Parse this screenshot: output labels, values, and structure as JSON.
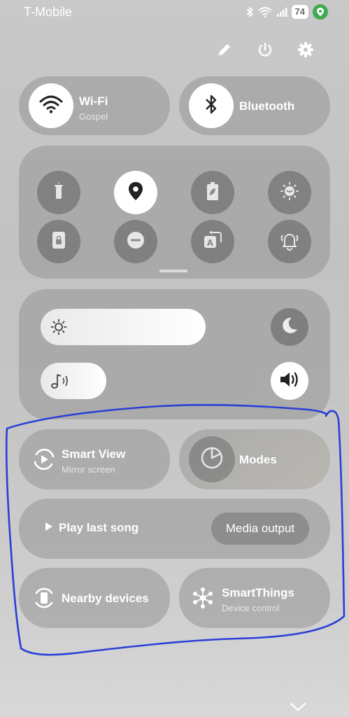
{
  "status_bar": {
    "carrier": "T-Mobile",
    "battery": "74",
    "icons": [
      "bluetooth-icon",
      "wifi-icon",
      "signal-icon",
      "battery-icon",
      "location-badge-icon"
    ]
  },
  "top_actions": [
    "edit-icon",
    "power-icon",
    "settings-icon"
  ],
  "wifi": {
    "title": "Wi-Fi",
    "subtitle": "Gospel",
    "active": true
  },
  "bluetooth": {
    "title": "Bluetooth",
    "active": true
  },
  "quick_toggles": [
    {
      "icon": "flashlight-icon",
      "active": false
    },
    {
      "icon": "location-icon",
      "active": true
    },
    {
      "icon": "power-saving-icon",
      "active": false
    },
    {
      "icon": "eye-comfort-icon",
      "active": false
    },
    {
      "icon": "secure-folder-icon",
      "active": false
    },
    {
      "icon": "do-not-disturb-icon",
      "active": false
    },
    {
      "icon": "auto-rotate-icon",
      "active": false
    },
    {
      "icon": "sound-mode-icon",
      "active": false
    }
  ],
  "sliders": {
    "brightness": {
      "level": 0.75,
      "icon": "sun-icon",
      "side_icon": "moon-icon"
    },
    "volume": {
      "level": 0.3,
      "icon": "music-note-icon",
      "side_icon": "speaker-icon"
    }
  },
  "smart_view": {
    "title": "Smart View",
    "subtitle": "Mirror screen"
  },
  "modes": {
    "title": "Modes"
  },
  "media": {
    "play_label": "Play last song",
    "output_label": "Media output"
  },
  "nearby": {
    "title": "Nearby devices"
  },
  "smartthings": {
    "title": "SmartThings",
    "subtitle": "Device control"
  },
  "colors": {
    "annotation": "#2a3fd6",
    "active_circle": "#ffffff",
    "location_badge": "#3faa53"
  }
}
